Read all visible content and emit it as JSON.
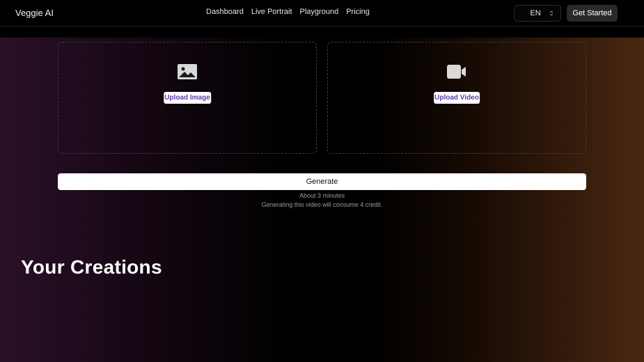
{
  "header": {
    "brand": "Veggie AI",
    "nav": [
      "Dashboard",
      "Live Portrait",
      "Playground",
      "Pricing"
    ],
    "language": "EN",
    "cta": "Get Started"
  },
  "upload": {
    "image_label": "Upload Image",
    "video_label": "Upload Video",
    "image_icon": "image-icon",
    "video_icon": "video-camera-icon"
  },
  "generate": {
    "label": "Generate",
    "duration": "About 3 minutes",
    "credit_note": "Generating this video will consume 4 credit."
  },
  "creations": {
    "title": "Your Creations"
  },
  "colors": {
    "accent_text": "#5b3ea8",
    "gradient_left": "#2a1028",
    "gradient_right": "#4a2811"
  }
}
